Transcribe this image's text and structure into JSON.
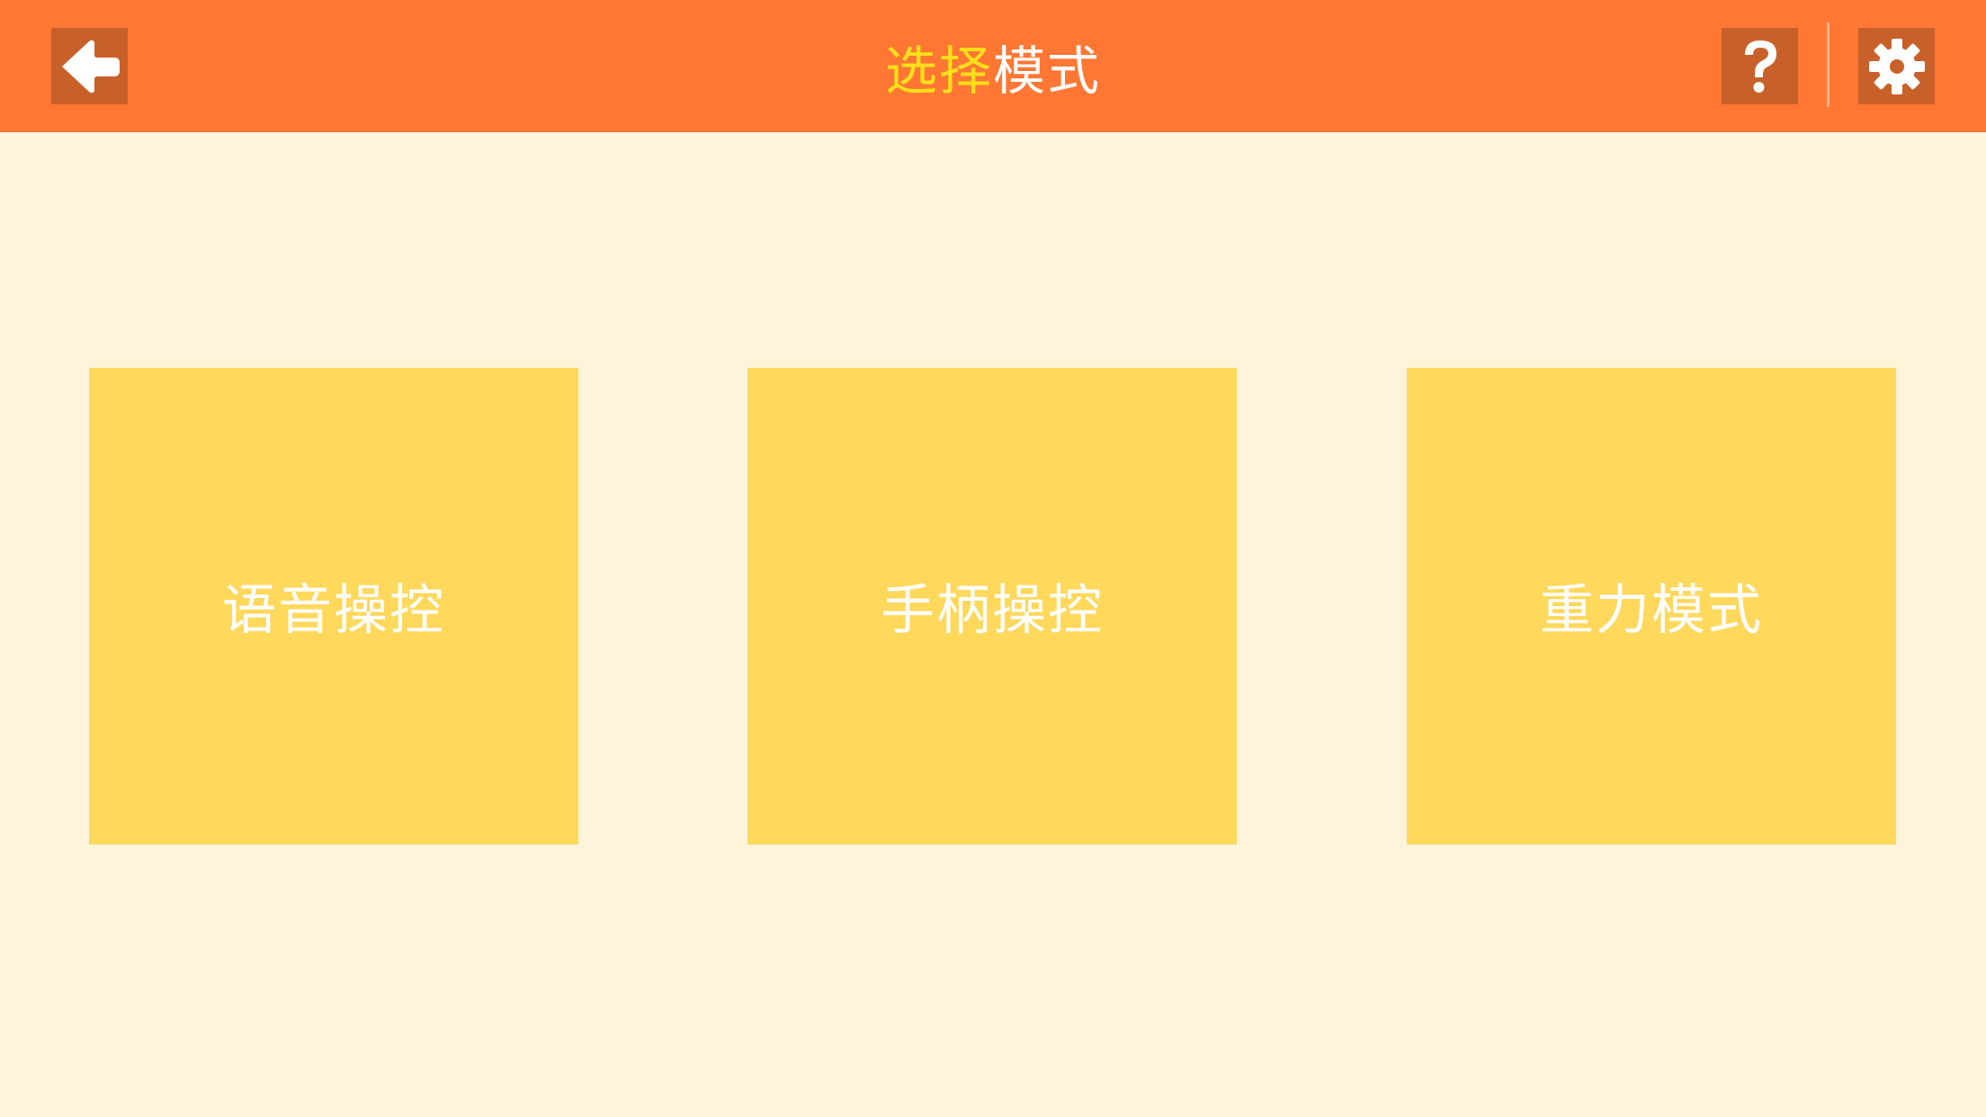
{
  "header": {
    "title_part1": "选择",
    "title_part2": "模式",
    "background": "#FF7733",
    "title_highlight_color": "#FFE01A",
    "back_icon": "arrow-left-icon",
    "help_icon": "question-mark-icon",
    "settings_icon": "gear-icon"
  },
  "modes": [
    {
      "label": "语音操控",
      "color": "#0AD5EC",
      "shadow_color": "#109A72"
    },
    {
      "label": "手柄操控",
      "color": "#BCDC02",
      "shadow_color": "#7E8A0E"
    },
    {
      "label": "重力模式",
      "color": "#B485FE",
      "shadow_color": "#6C3250"
    }
  ],
  "page_background": "#FDF4DA",
  "card_background": "#FFD85C"
}
